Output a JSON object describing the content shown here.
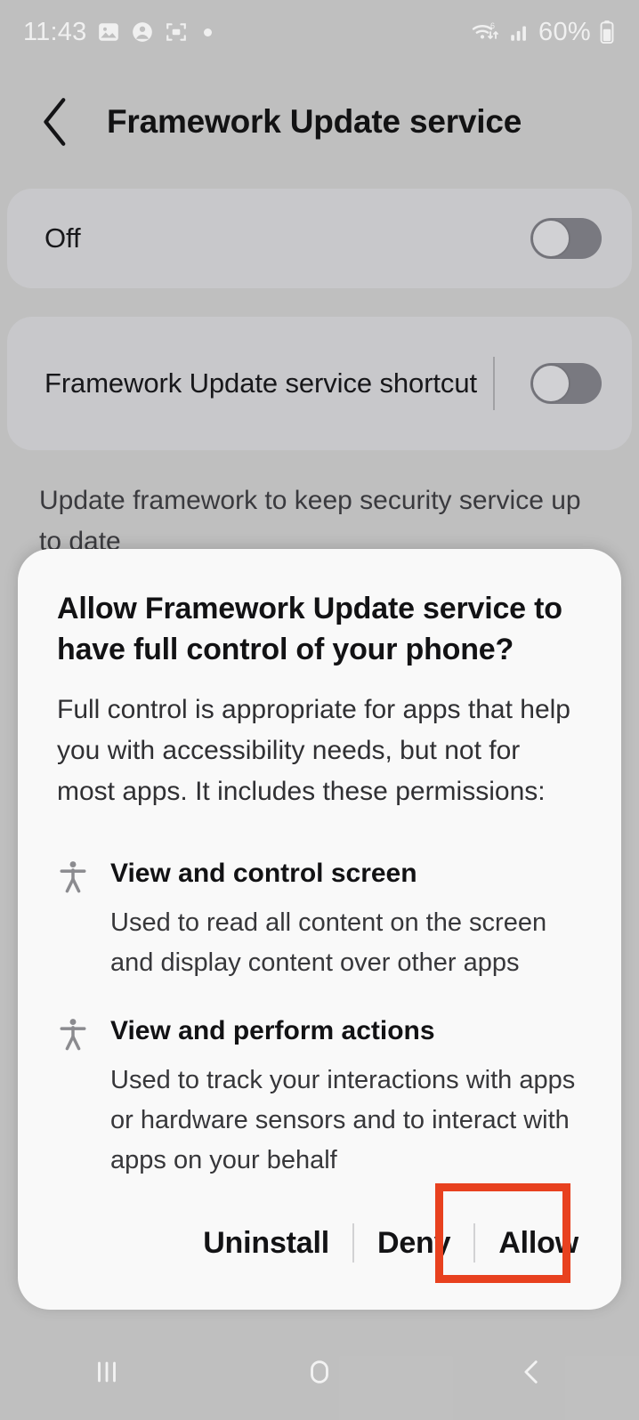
{
  "statusbar": {
    "time": "11:43",
    "battery_percent": "60%",
    "icons_left": [
      "photo-icon",
      "contact-icon",
      "screenshot-capture-icon",
      "dot-indicator-icon"
    ],
    "icons_right": [
      "wifi-6-icon",
      "cellular-signal-icon",
      "battery-icon"
    ]
  },
  "header": {
    "back_icon": "chevron-left-icon",
    "title": "Framework Update service"
  },
  "settings": {
    "rows": [
      {
        "label": "Off",
        "toggle_state": "off"
      },
      {
        "label": "Framework Update service shortcut",
        "toggle_state": "off"
      }
    ],
    "description": "Update framework to keep security service up to date"
  },
  "dialog": {
    "title": "Allow Framework Update service to have full control of your phone?",
    "body": "Full control is appropriate for apps that help you with accessibility needs, but not for most apps. It includes these permissions:",
    "permissions": [
      {
        "icon": "accessibility-person-icon",
        "title": "View and control screen",
        "description": "Used to read all content on the screen and display content over other apps"
      },
      {
        "icon": "accessibility-person-icon",
        "title": "View and perform actions",
        "description": "Used to track your interactions with apps or hardware sensors and to interact with apps on your behalf"
      }
    ],
    "buttons": [
      {
        "label": "Uninstall"
      },
      {
        "label": "Deny"
      },
      {
        "label": "Allow"
      }
    ],
    "highlight": {
      "target": "Allow",
      "color": "#e8411f"
    }
  },
  "navbar": {
    "recents_icon": "recents-icon",
    "home_icon": "home-icon",
    "back_icon": "nav-back-icon"
  },
  "colors": {
    "screen_bg": "#c9c9c9",
    "card_bg": "#d3d3d6",
    "dialog_bg": "#f9f9f9",
    "accent_highlight": "#e8411f",
    "toggle_track": "#7f7f86"
  }
}
